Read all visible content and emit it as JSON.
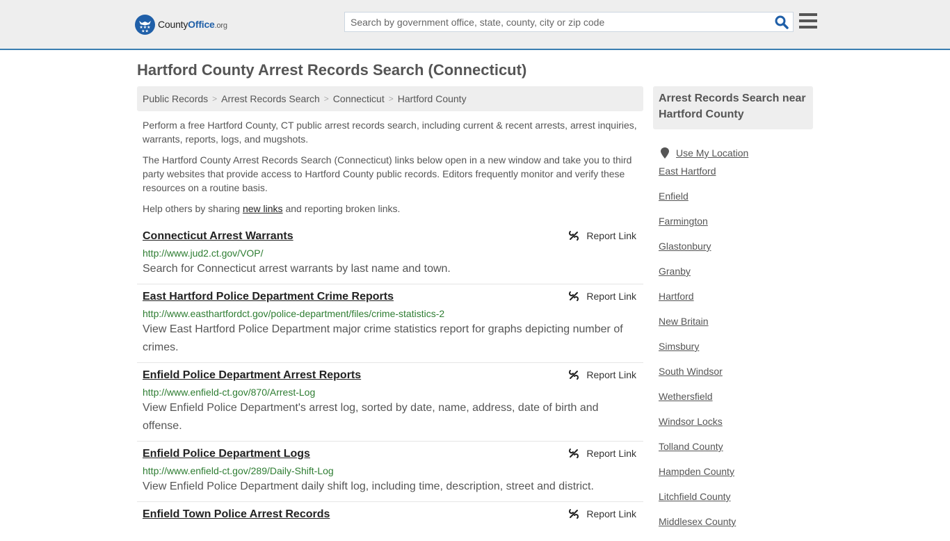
{
  "header": {
    "logo": {
      "county": "County",
      "office": "Office",
      "org": ".org"
    },
    "search": {
      "placeholder": "Search by government office, state, county, city or zip code",
      "value": ""
    },
    "icons": {
      "search": "search-icon",
      "menu": "hamburger-menu-icon"
    }
  },
  "page": {
    "title": "Hartford County Arrest Records Search (Connecticut)"
  },
  "breadcrumb": [
    {
      "label": "Public Records"
    },
    {
      "label": "Arrest Records Search"
    },
    {
      "label": "Connecticut"
    },
    {
      "label": "Hartford County"
    }
  ],
  "breadcrumb_separator": ">",
  "intro": {
    "p1": "Perform a free Hartford County, CT public arrest records search, including current & recent arrests, arrest inquiries, warrants, reports, logs, and mugshots.",
    "p2": "The Hartford County Arrest Records Search (Connecticut) links below open in a new window and take you to third party websites that provide access to Hartford County public records. Editors frequently monitor and verify these resources on a routine basis.",
    "p3_before": "Help others by sharing ",
    "p3_link": "new links",
    "p3_after": " and reporting broken links."
  },
  "report_label": "Report Link",
  "results": [
    {
      "title": "Connecticut Arrest Warrants",
      "url": "http://www.jud2.ct.gov/VOP/",
      "description": "Search for Connecticut arrest warrants by last name and town."
    },
    {
      "title": "East Hartford Police Department Crime Reports",
      "url": "http://www.easthartfordct.gov/police-department/files/crime-statistics-2",
      "description": "View East Hartford Police Department major crime statistics report for graphs depicting number of crimes."
    },
    {
      "title": "Enfield Police Department Arrest Reports",
      "url": "http://www.enfield-ct.gov/870/Arrest-Log",
      "description": "View Enfield Police Department's arrest log, sorted by date, name, address, date of birth and offense."
    },
    {
      "title": "Enfield Police Department Logs",
      "url": "http://www.enfield-ct.gov/289/Daily-Shift-Log",
      "description": "View Enfield Police Department daily shift log, including time, description, street and district."
    },
    {
      "title": "Enfield Town Police Arrest Records",
      "url": "",
      "description": ""
    }
  ],
  "sidebar": {
    "heading": "Arrest Records Search near Hartford County",
    "use_location": "Use My Location",
    "links": [
      "East Hartford",
      "Enfield",
      "Farmington",
      "Glastonbury",
      "Granby",
      "Hartford",
      "New Britain",
      "Simsbury",
      "South Windsor",
      "Wethersfield",
      "Windsor Locks",
      "Tolland County",
      "Hampden County",
      "Litchfield County",
      "Middlesex County"
    ]
  },
  "colors": {
    "brand_blue": "#1f5fa8",
    "header_border": "#3a7db0",
    "url_green": "#2e7d32",
    "panel_gray": "#eeeeee"
  }
}
